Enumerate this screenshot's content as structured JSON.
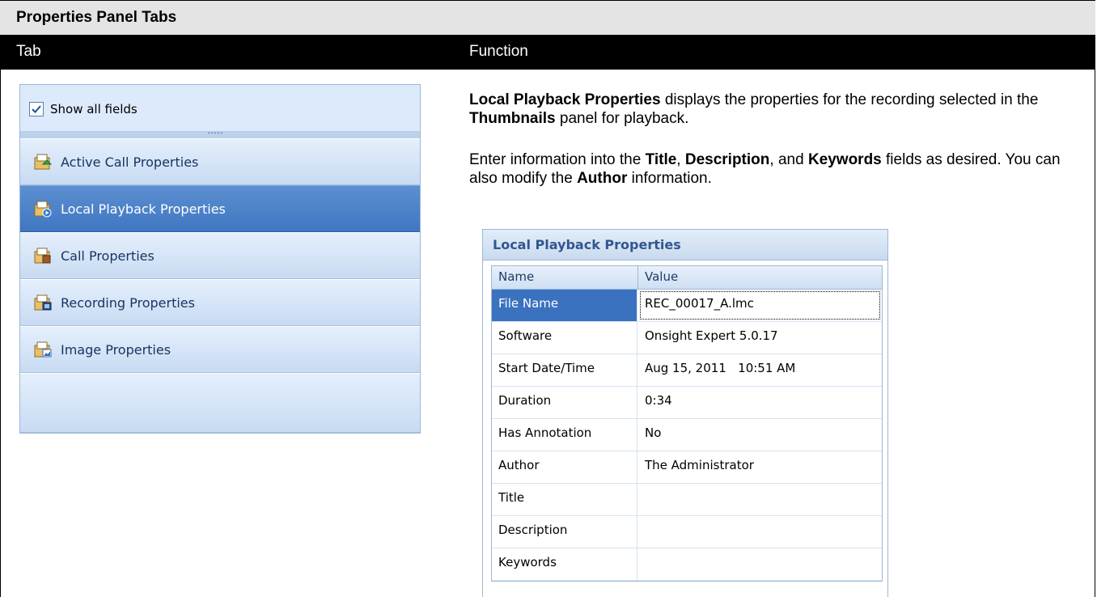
{
  "table": {
    "title": "Properties Panel Tabs",
    "col_tab": "Tab",
    "col_function": "Function"
  },
  "tabs_panel": {
    "show_all_label": "Show all fields",
    "show_all_checked": true,
    "items": [
      {
        "label": "Active Call Properties",
        "icon": "active-call-properties-icon"
      },
      {
        "label": "Local Playback Properties",
        "icon": "local-playback-properties-icon",
        "selected": true
      },
      {
        "label": "Call Properties",
        "icon": "call-properties-icon"
      },
      {
        "label": "Recording Properties",
        "icon": "recording-properties-icon"
      },
      {
        "label": "Image Properties",
        "icon": "image-properties-icon"
      }
    ]
  },
  "function_text": {
    "p1": {
      "b1": "Local Playback Properties",
      "t1": " displays the properties for the recording selected in the ",
      "b2": "Thumbnails",
      "t2": " panel for playback."
    },
    "p2": {
      "t0": "Enter information into the ",
      "b1": "Title",
      "t1": ", ",
      "b2": "Description",
      "t2": ", and ",
      "b3": "Keywords",
      "t3": " fields as desired. You can also modify the ",
      "b4": "Author",
      "t4": " information."
    }
  },
  "properties_panel": {
    "title": "Local Playback Properties",
    "col_name": "Name",
    "col_value": "Value",
    "rows": [
      {
        "name": "File Name",
        "value": "REC_00017_A.lmc",
        "selected": true
      },
      {
        "name": "Software",
        "value": "Onsight Expert 5.0.17"
      },
      {
        "name": "Start Date/Time",
        "value": "Aug 15, 2011   10:51 AM"
      },
      {
        "name": "Duration",
        "value": "0:34"
      },
      {
        "name": "Has Annotation",
        "value": "No"
      },
      {
        "name": "Author",
        "value": "The Administrator"
      },
      {
        "name": "Title",
        "value": ""
      },
      {
        "name": "Description",
        "value": ""
      },
      {
        "name": "Keywords",
        "value": ""
      }
    ]
  },
  "colors": {
    "header_bg": "#000000",
    "title_bg": "#e4e4e4",
    "selected_tab": "#4a80c8",
    "selected_cell": "#3a72c0"
  }
}
